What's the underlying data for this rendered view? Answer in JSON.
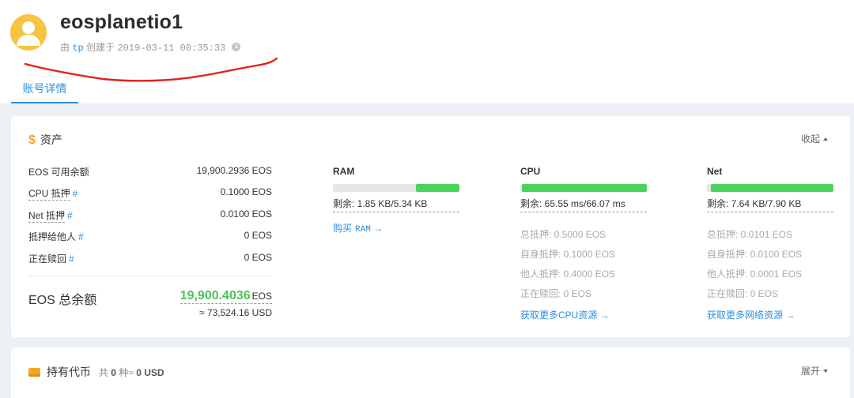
{
  "account": {
    "name": "eosplanetio1",
    "created_prefix": "由",
    "creator": "tp",
    "created_label": "创建于",
    "created_time": "2019-03-11 00:35:33"
  },
  "tabs": [
    {
      "label": "账号详情",
      "active": true
    }
  ],
  "assets": {
    "title": "资产",
    "toggle": "收起",
    "rows": [
      {
        "label": "EOS 可用余额",
        "value": "19,900.2936 EOS"
      },
      {
        "label": "CPU 抵押",
        "hash": "#",
        "value": "0.1000 EOS"
      },
      {
        "label": "Net 抵押",
        "hash": "#",
        "value": "0.0100 EOS"
      },
      {
        "label": "抵押给他人",
        "hash": "#",
        "value": "0 EOS"
      },
      {
        "label": "正在赎回",
        "hash": "#",
        "value": "0 EOS"
      }
    ],
    "total_label": "EOS 总余额",
    "total_amount": "19,900.4036",
    "total_unit": "EOS",
    "total_usd": "≈ 73,524.16 USD"
  },
  "resources": {
    "ram": {
      "title": "RAM",
      "used_fraction": 0.346,
      "remaining": "剩余: 1.85 KB/5.34 KB",
      "buy_label": "购买",
      "buy_target": "RAM",
      "arrow": "→"
    },
    "cpu": {
      "title": "CPU",
      "used_fraction": 0.99,
      "remaining": "剩余: 65.55 ms/66.07 ms",
      "details": [
        "总抵押: 0.5000 EOS",
        "自身抵押: 0.1000 EOS",
        "他人抵押: 0.4000 EOS",
        "正在赎回: 0 EOS"
      ],
      "link": "获取更多CPU资源 →"
    },
    "net": {
      "title": "Net",
      "used_fraction": 0.967,
      "remaining": "剩余: 7.64 KB/7.90 KB",
      "details": [
        "总抵押: 0.0101 EOS",
        "自身抵押: 0.0100 EOS",
        "他人抵押: 0.0001 EOS",
        "正在赎回: 0 EOS"
      ],
      "link": "获取更多网络资源 →"
    }
  },
  "tokens": {
    "title": "持有代币",
    "count_prefix": "共",
    "count": "0",
    "count_mid": "种≈",
    "usd": "0 USD",
    "toggle": "展开"
  },
  "colors": {
    "accent": "#2f8fe0",
    "green": "#4cd35c",
    "gold": "#f5a623",
    "scribble": "#e0211d"
  },
  "icons": [
    "user-avatar-icon",
    "clock-icon",
    "dollar-icon",
    "coins-icon",
    "caret-up-icon",
    "caret-down-icon"
  ]
}
